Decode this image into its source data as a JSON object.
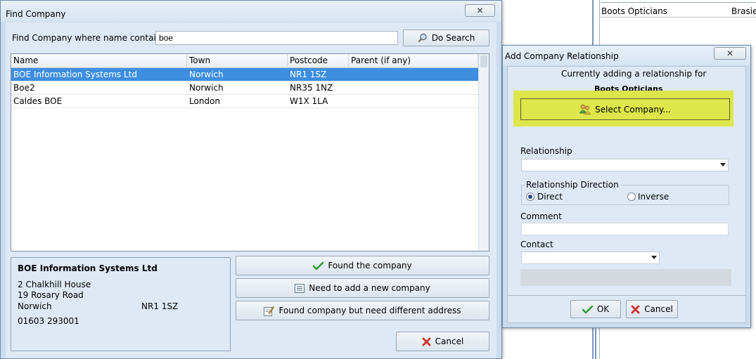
{
  "background": {
    "row_values": [
      "Boots Opticians",
      "Brasier"
    ]
  },
  "find_window": {
    "title": "Find Company",
    "close_label": "✕",
    "search_label": "Find Company where name contains",
    "search_value": "boe",
    "do_search_label": "Do Search",
    "columns": [
      "Name",
      "Town",
      "Postcode",
      "Parent (if any)"
    ],
    "rows": [
      {
        "name": "BOE Information Systems Ltd",
        "town": "Norwich",
        "postcode": "NR1 1SZ",
        "parent": ""
      },
      {
        "name": "Boe2",
        "town": "Norwich",
        "postcode": "NR35 1NZ",
        "parent": ""
      },
      {
        "name": "Caldes BOE",
        "town": "London",
        "postcode": "W1X 1LA",
        "parent": ""
      }
    ],
    "detail": {
      "company_name": "BOE Information Systems Ltd",
      "address1": "2 Chalkhill House",
      "address2": "19 Rosary Road",
      "city": "Norwich",
      "postcode": "NR1 1SZ",
      "phone": "01603 293001"
    },
    "found_label": "Found the company",
    "add_new_label": "Need to add a new company",
    "diff_address_label": "Found company but need different address",
    "cancel_label": "Cancel"
  },
  "relationship_window": {
    "title": "Add Company Relationship",
    "close_label": "✕",
    "intro": "Currently adding a relationship for",
    "company": "Boots Opticians",
    "select_company_label": "Select Company...",
    "relationship_label": "Relationship",
    "relationship_value": "",
    "direction_label": "Relationship Direction",
    "direction_options": [
      "Direct",
      "Inverse"
    ],
    "comment_label": "Comment",
    "comment_value": "",
    "contact_label": "Contact",
    "contact_value": "",
    "ok_label": "OK",
    "cancel_label": "Cancel"
  },
  "colors": {
    "highlight": "#dde64b",
    "selection": "#3d8ee0"
  }
}
